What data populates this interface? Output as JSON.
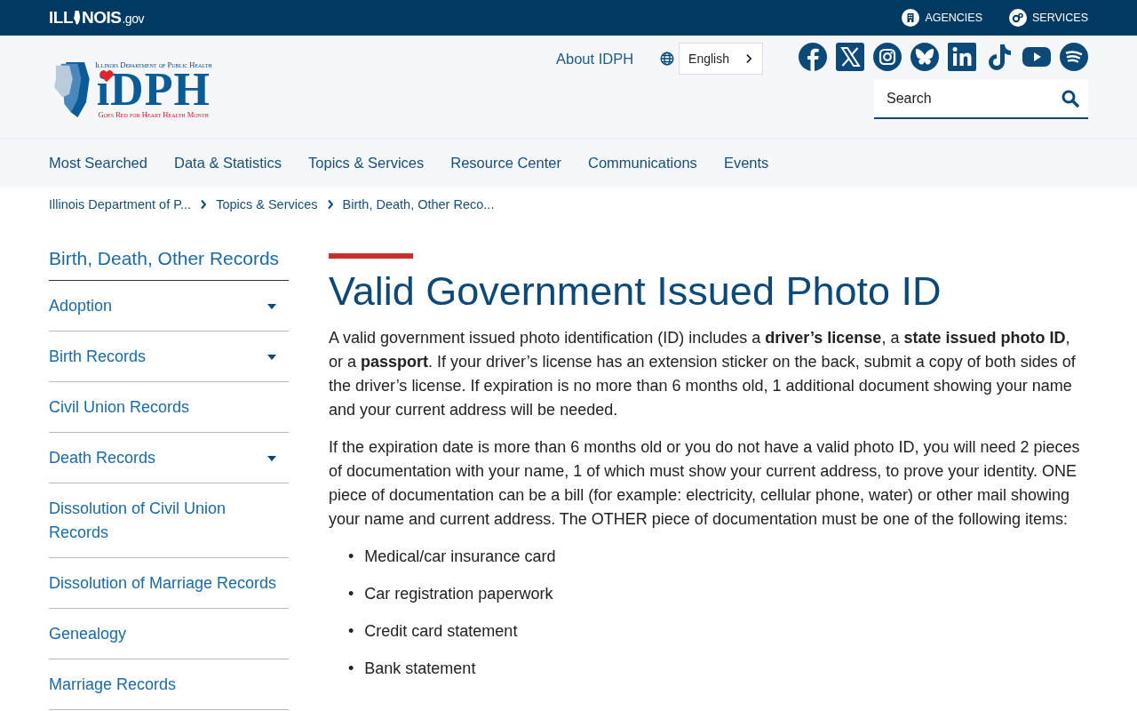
{
  "top_bar": {
    "logo": {
      "prefix": "ILL",
      "suffix": "NOIS",
      "domain": ".gov"
    },
    "links": [
      {
        "label": "AGENCIES",
        "kind": "building"
      },
      {
        "label": "SERVICES",
        "kind": "gears"
      }
    ]
  },
  "header": {
    "logo": {
      "department": "Illinois Department of Public Health",
      "acronym": "iDPH",
      "tagline": "Goes Red for Heart Health Month"
    },
    "about_link": "About IDPH",
    "language": "English",
    "search": {
      "placeholder": "Search"
    }
  },
  "nav": [
    "Most Searched",
    "Data & Statistics",
    "Topics & Services",
    "Resource Center",
    "Communications",
    "Events"
  ],
  "breadcrumbs": [
    "Illinois Department of P...",
    "Topics & Services",
    "Birth, Death, Other Reco..."
  ],
  "sidebar": {
    "title": "Birth, Death, Other Records",
    "items": [
      {
        "label": "Adoption",
        "expandable": true
      },
      {
        "label": "Birth Records",
        "expandable": true
      },
      {
        "label": "Civil Union Records",
        "expandable": false
      },
      {
        "label": "Death Records",
        "expandable": true
      },
      {
        "label": "Dissolution of Civil Union Records",
        "expandable": false
      },
      {
        "label": "Dissolution of Marriage Records",
        "expandable": false
      },
      {
        "label": "Genealogy",
        "expandable": false
      },
      {
        "label": "Marriage Records",
        "expandable": false
      }
    ]
  },
  "article": {
    "title": "Valid Government Issued Photo ID",
    "paragraphs": [
      "A valid government issued photo identification (ID) includes a **driver’s license**, a **state issued photo ID**, or a **passport**. If your driver’s license has an extension sticker on the back, submit a copy of both sides of the driver’s license. If expiration is no more than 6 months old, 1 additional document showing your name and your current address will be needed.",
      "If the expiration date is more than 6 months old or you do not have a valid photo ID, you will need 2 pieces of documentation with your name, 1 of which must show your current address, to prove your identity. ONE piece of documentation can be a bill (for example: electricity, cellular phone, water) or other mail showing your name and current address. The OTHER piece of documentation must be one of the following items:"
    ],
    "list": {
      "marker": "•",
      "items": [
        "Medical/car insurance card",
        "Car registration paperwork",
        "Credit card statement",
        "Bank statement"
      ]
    }
  }
}
